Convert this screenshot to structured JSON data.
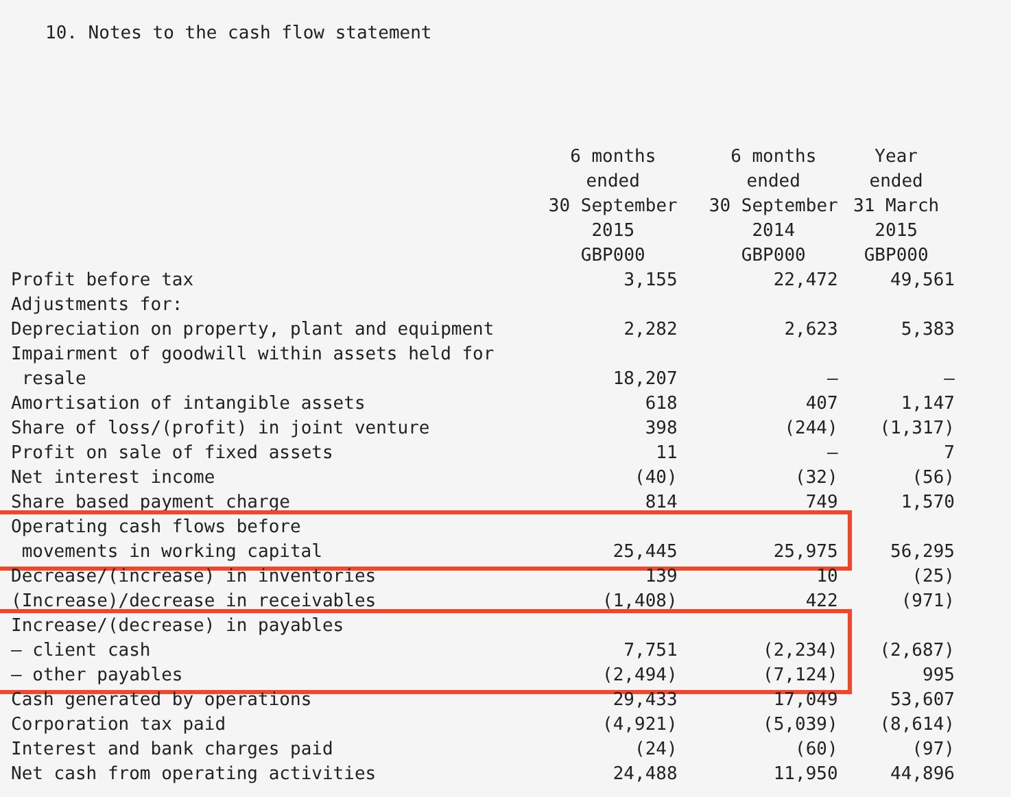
{
  "title": "10. Notes to the cash flow statement",
  "columns": [
    {
      "lines": [
        "6 months",
        "ended",
        "30 September",
        "2015",
        "GBP000"
      ]
    },
    {
      "lines": [
        "6 months",
        "ended",
        "30 September",
        "2014",
        "GBP000"
      ]
    },
    {
      "lines": [
        "Year",
        "ended",
        "31 March",
        "2015",
        "GBP000"
      ]
    }
  ],
  "sections": [
    {
      "highlighted": false,
      "rows": [
        {
          "label": "Profit before tax",
          "values": [
            "3,155",
            "22,472",
            "49,561"
          ]
        },
        {
          "label": "Adjustments for:",
          "values": []
        },
        {
          "label": "Depreciation on property, plant and equipment",
          "values": [
            "2,282",
            "2,623",
            "5,383"
          ]
        },
        {
          "label": [
            "Impairment of goodwill within assets held for",
            "resale"
          ],
          "values": [
            "18,207",
            "–",
            "–"
          ]
        },
        {
          "label": "Amortisation of intangible assets",
          "values": [
            "618",
            "407",
            "1,147"
          ]
        },
        {
          "label": "Share of loss/(profit) in joint venture",
          "values": [
            "398",
            "(244)",
            "(1,317)"
          ]
        },
        {
          "label": "Profit on sale of fixed assets",
          "values": [
            "11",
            "–",
            "7"
          ]
        },
        {
          "label": "Net interest income",
          "values": [
            "(40)",
            "(32)",
            "(56)"
          ]
        },
        {
          "label": "Share based payment charge",
          "values": [
            "814",
            "749",
            "1,570"
          ]
        }
      ]
    },
    {
      "highlighted": true,
      "rows": [
        {
          "label": [
            "Operating cash flows before",
            "movements in working capital"
          ],
          "values": [
            "25,445",
            "25,975",
            "56,295"
          ]
        }
      ]
    },
    {
      "highlighted": false,
      "rows": [
        {
          "label": "Decrease/(increase) in inventories",
          "values": [
            "139",
            "10",
            "(25)"
          ]
        },
        {
          "label": "(Increase)/decrease in receivables",
          "values": [
            "(1,408)",
            "422",
            "(971)"
          ]
        }
      ]
    },
    {
      "highlighted": true,
      "rows": [
        {
          "label": "Increase/(decrease) in payables",
          "values": []
        },
        {
          "label": "– client cash",
          "values": [
            "7,751",
            "(2,234)",
            "(2,687)"
          ]
        },
        {
          "label": "– other payables",
          "values": [
            "(2,494)",
            "(7,124)",
            "995"
          ]
        }
      ]
    },
    {
      "highlighted": false,
      "rows": [
        {
          "label": "Cash generated by operations",
          "values": [
            "29,433",
            "17,049",
            "53,607"
          ]
        },
        {
          "label": "Corporation tax paid",
          "values": [
            "(4,921)",
            "(5,039)",
            "(8,614)"
          ]
        },
        {
          "label": "Interest and bank charges paid",
          "values": [
            "(24)",
            "(60)",
            "(97)"
          ]
        },
        {
          "label": "Net cash from operating activities",
          "values": [
            "24,488",
            "11,950",
            "44,896"
          ]
        }
      ]
    }
  ]
}
